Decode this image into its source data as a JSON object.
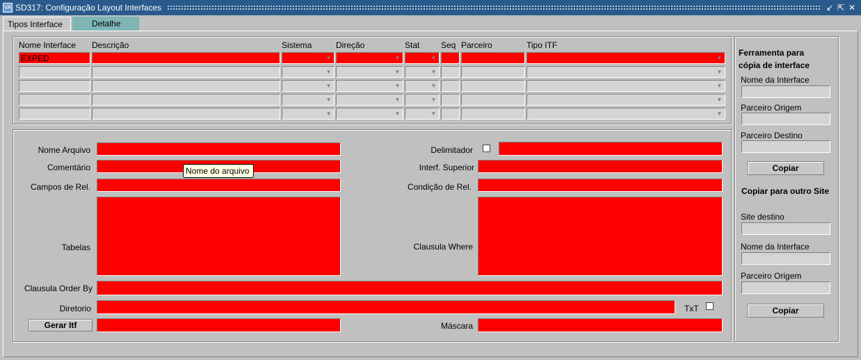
{
  "window": {
    "title": "SD317: Configuração Layout Interfaces",
    "icon_label": "VA",
    "controls": [
      "minimize-icon",
      "restore-icon",
      "close-icon"
    ]
  },
  "tabs": [
    {
      "label": "Tipos Interface",
      "active": true
    },
    {
      "label": "Detalhe",
      "active": false
    }
  ],
  "grid": {
    "headers": {
      "nome": "Nome Interface",
      "descricao": "Descrição",
      "sistema": "Sistema",
      "direcao": "Direção",
      "stat": "Stat",
      "seq": "Seq",
      "parceiro": "Parceiro",
      "tipo": "Tipo ITF"
    },
    "rows": [
      {
        "nome": "EXPED",
        "descricao": "",
        "sistema": "",
        "direcao": "",
        "stat": "",
        "seq": "",
        "parceiro": "",
        "tipo": ""
      },
      {
        "nome": "",
        "descricao": "",
        "sistema": "",
        "direcao": "",
        "stat": "",
        "seq": "",
        "parceiro": "",
        "tipo": ""
      },
      {
        "nome": "",
        "descricao": "",
        "sistema": "",
        "direcao": "",
        "stat": "",
        "seq": "",
        "parceiro": "",
        "tipo": ""
      },
      {
        "nome": "",
        "descricao": "",
        "sistema": "",
        "direcao": "",
        "stat": "",
        "seq": "",
        "parceiro": "",
        "tipo": ""
      },
      {
        "nome": "",
        "descricao": "",
        "sistema": "",
        "direcao": "",
        "stat": "",
        "seq": "",
        "parceiro": "",
        "tipo": ""
      }
    ]
  },
  "detail": {
    "nome_arquivo": "Nome Arquivo",
    "comentario": "Comentário",
    "campos_rel": "Campos de Rel.",
    "tabelas": "Tabelas",
    "order_by": "Clausula Order By",
    "diretorio": "Diretorio",
    "gerar_itf": "Gerar Itf",
    "delimitador": "Delimitador",
    "interf_superior": "Interf. Superior",
    "condicao_rel": "Condição de Rel.",
    "clausula_where": "Clausula Where",
    "txt": "TxT",
    "mascara": "Máscara",
    "tooltip": "Nome do arquivo"
  },
  "side": {
    "copy_title": "Ferramenta para cópia de interface",
    "nome_interface": "Nome da Interface",
    "parceiro_origem": "Parceiro Origem",
    "parceiro_destino": "Parceiro Destino",
    "copiar": "Copiar",
    "site_title": "Copiar para outro Site",
    "site_destino": "Site destino",
    "nome_interface2": "Nome da Interface",
    "parceiro_origem2": "Parceiro Origem",
    "copiar2": "Copiar"
  },
  "colors": {
    "required": "#ff0000",
    "titlebar": "#2a5a8c",
    "inactive_tab": "#7fb5b5"
  }
}
